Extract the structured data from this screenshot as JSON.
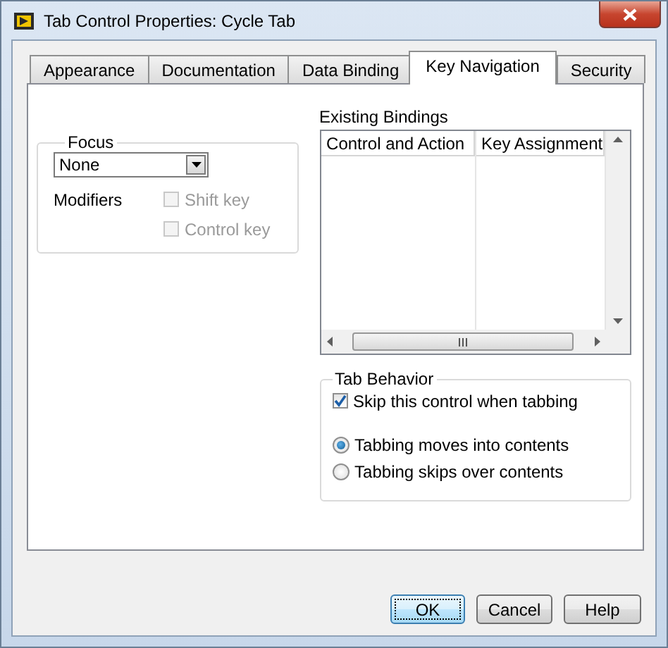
{
  "window": {
    "title": "Tab Control Properties: Cycle Tab"
  },
  "tabs": [
    {
      "label": "Appearance",
      "selected": false
    },
    {
      "label": "Documentation",
      "selected": false
    },
    {
      "label": "Data Binding",
      "selected": false
    },
    {
      "label": "Key Navigation",
      "selected": true
    },
    {
      "label": "Security",
      "selected": false
    }
  ],
  "focus": {
    "label": "Focus",
    "value": "None"
  },
  "modifiers": {
    "label": "Modifiers",
    "options": [
      {
        "label": "Shift key",
        "checked": false,
        "disabled": true
      },
      {
        "label": "Control key",
        "checked": false,
        "disabled": true
      }
    ]
  },
  "bindings": {
    "label": "Existing Bindings",
    "columns": [
      "Control and Action",
      "Key Assignment"
    ]
  },
  "tab_behavior": {
    "label": "Tab Behavior",
    "skip": {
      "label": "Skip this control when tabbing",
      "checked": true
    },
    "options": [
      {
        "label": "Tabbing moves into contents",
        "selected": true
      },
      {
        "label": "Tabbing skips over contents",
        "selected": false
      }
    ]
  },
  "buttons": [
    {
      "label": "OK",
      "default": true
    },
    {
      "label": "Cancel",
      "default": false
    },
    {
      "label": "Help",
      "default": false
    }
  ]
}
